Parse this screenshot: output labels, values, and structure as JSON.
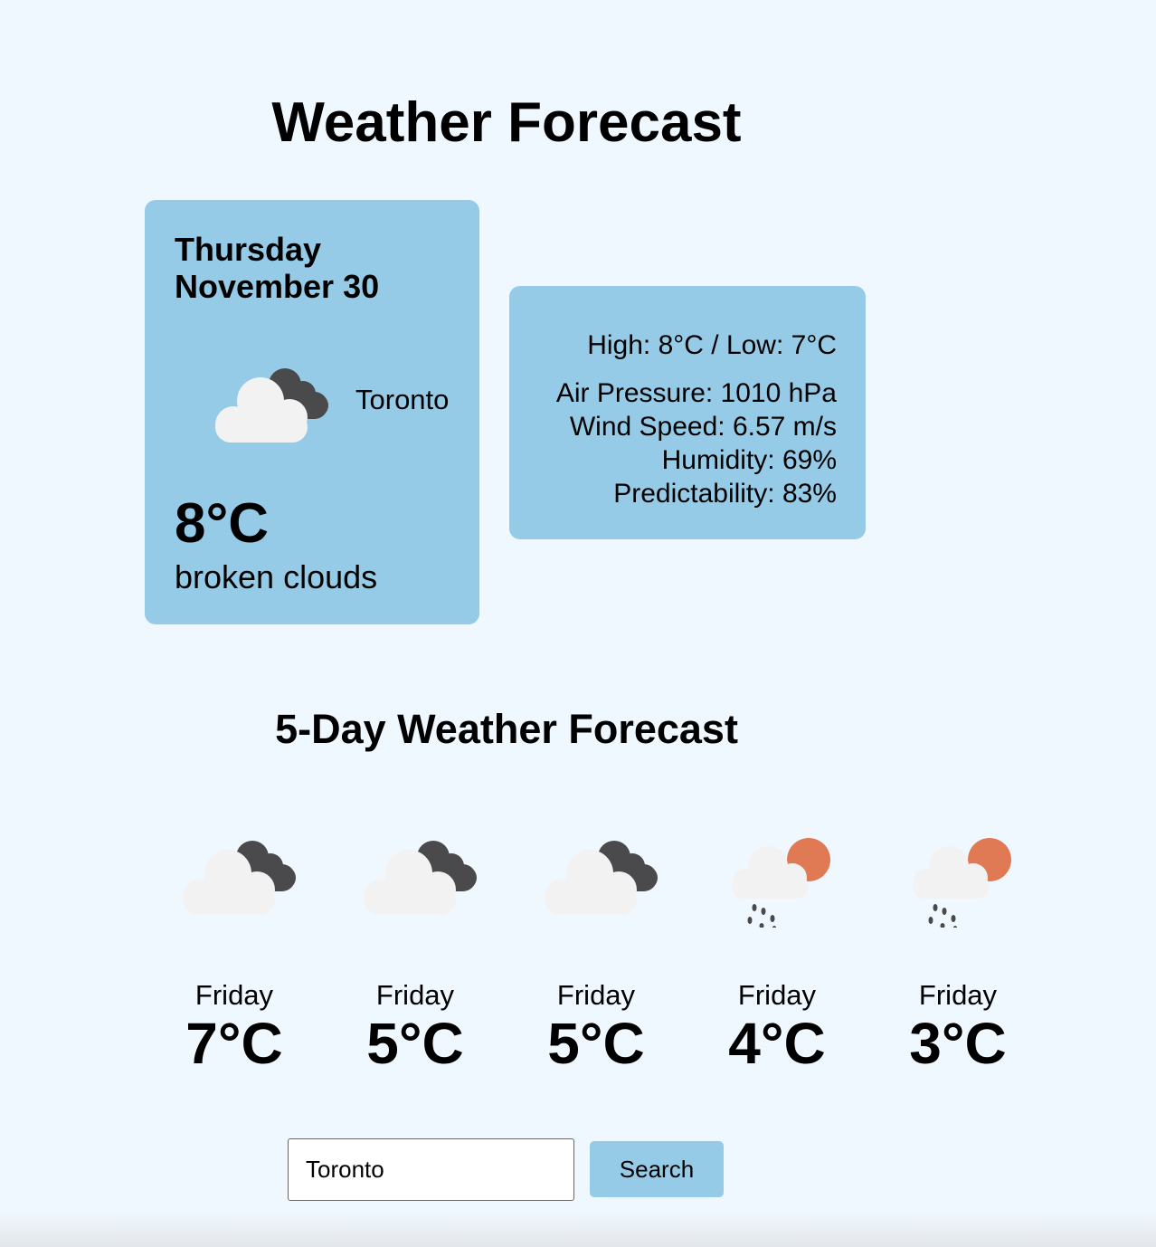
{
  "title": "Weather Forecast",
  "current": {
    "day": "Thursday",
    "date": "November 30",
    "city": "Toronto",
    "temp": "8°C",
    "description": "broken clouds",
    "icon": "broken-clouds-icon"
  },
  "details": {
    "high_low": "High: 8°C / Low: 7°C",
    "pressure": "Air Pressure: 1010 hPa",
    "wind": "Wind Speed: 6.57 m/s",
    "humidity": "Humidity: 69%",
    "predictability": "Predictability: 83%"
  },
  "forecast_title": "5-Day Weather Forecast",
  "forecast": [
    {
      "day": "Friday",
      "temp": "7°C",
      "icon": "broken-clouds-icon"
    },
    {
      "day": "Friday",
      "temp": "5°C",
      "icon": "broken-clouds-icon"
    },
    {
      "day": "Friday",
      "temp": "5°C",
      "icon": "broken-clouds-icon"
    },
    {
      "day": "Friday",
      "temp": "4°C",
      "icon": "light-rain-sun-icon"
    },
    {
      "day": "Friday",
      "temp": "3°C",
      "icon": "light-rain-sun-icon"
    }
  ],
  "search": {
    "value": "Toronto",
    "button": "Search"
  }
}
